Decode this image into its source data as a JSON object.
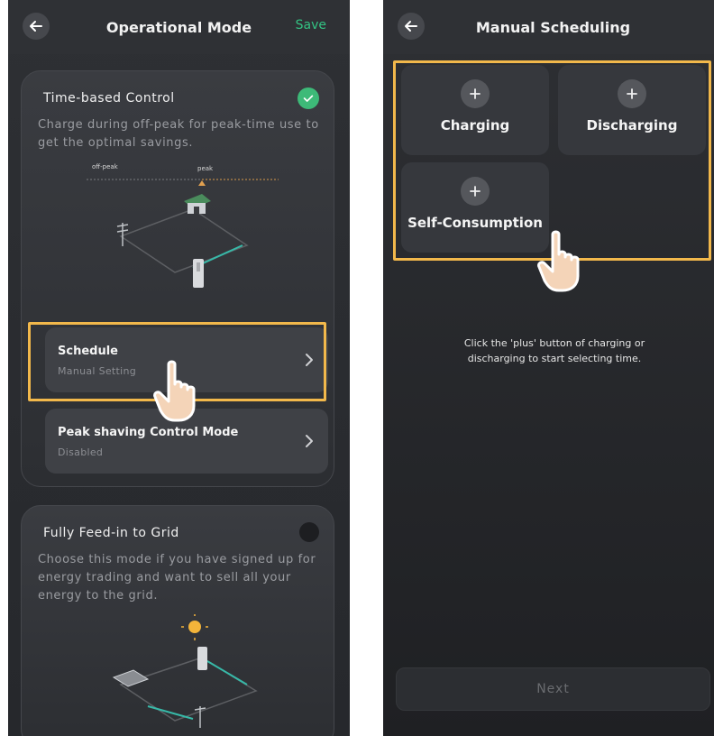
{
  "left_screen": {
    "title": "Operational Mode",
    "save_label": "Save",
    "time_based": {
      "title": "Time-based Control",
      "description": "Charge during off-peak for peak-time use to get the optimal savings.",
      "timeline_labels": [
        "off-peak",
        "peak"
      ],
      "selected": true
    },
    "schedule_row": {
      "title": "Schedule",
      "subtitle": "Manual Setting"
    },
    "peak_row": {
      "title": "Peak shaving Control Mode",
      "subtitle": "Disabled"
    },
    "feed_in": {
      "title": "Fully Feed-in to Grid",
      "description": "Choose this mode if you have signed up for energy trading and want to sell all your energy to the grid.",
      "selected": false
    }
  },
  "right_screen": {
    "title": "Manual Scheduling",
    "tiles": [
      {
        "label": "Charging"
      },
      {
        "label": "Discharging"
      },
      {
        "label": "Self-Consumption"
      }
    ],
    "hint": "Click the 'plus' button of charging or discharging to start selecting time.",
    "next_label": "Next"
  },
  "colors": {
    "accent_green": "#3dba78",
    "save_green": "#33c383",
    "highlight_orange": "#f2b84b",
    "background": "#2b2d31"
  },
  "icons": [
    "back-arrow-icon",
    "check-icon",
    "chevron-right-icon",
    "plus-icon",
    "hand-pointer-icon",
    "sun-icon",
    "house-icon",
    "battery-icon",
    "utility-pole-icon",
    "solar-panel-icon"
  ]
}
